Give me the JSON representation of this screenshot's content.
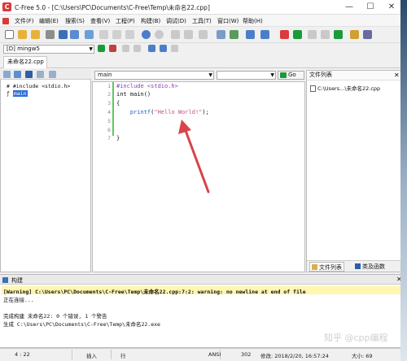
{
  "window": {
    "title": "C-Free 5.0 - [C:\\Users\\PC\\Documents\\C-Free\\Temp\\未命名22.cpp]",
    "app_icon": "C",
    "minimize": "—",
    "maximize": "☐",
    "close": "✕"
  },
  "menu": [
    "文件(F)",
    "编辑(E)",
    "搜索(S)",
    "查看(V)",
    "工程(P)",
    "构建(B)",
    "调试(D)",
    "工具(T)",
    "窗口(W)",
    "帮助(H)"
  ],
  "compiler": {
    "value": "[D] mingw5"
  },
  "file_tab": "未命名22.cpp",
  "project_tree": {
    "include_item": "#include <stdio.h>",
    "main_item": "main",
    "include_glyph": "#",
    "func_glyph": "ƒ"
  },
  "editor": {
    "scope_combo": "main",
    "go_button": "Go",
    "line_numbers": [
      "1",
      "2",
      "3",
      "4",
      "5",
      "6",
      "7"
    ],
    "code": {
      "line1": "#include <stdio.h>",
      "line2": "int main()",
      "line3": "{",
      "line4_indent": "    ",
      "line4_fn": "printf",
      "line4_open": "(",
      "line4_str": "\"Hello World!\"",
      "line4_close": ");",
      "line7": "}"
    }
  },
  "file_list": {
    "header": "文件列表",
    "close": "✕",
    "item": "C:\\Users...\\未命名22.cpp",
    "tab_files": "文件列表",
    "tab_funcs": "类及函数"
  },
  "build": {
    "header": "构建",
    "close": "✕",
    "lines": [
      "[Warning] C:\\Users\\PC\\Documents\\C-Free\\Temp\\未命名22.cpp:7:2: warning: no newline at end of file",
      "正在连接...",
      "",
      "完成构建 未命名22: 0 个错误, 1 个警告",
      "生成 C:\\Users\\PC\\Documents\\C-Free\\Temp\\未命名22.exe"
    ]
  },
  "status": {
    "position": "4 : 22",
    "mode": "插入",
    "line_label": "行",
    "encoding": "ANSI",
    "size_value": "302",
    "modified": "修改: 2018/2/20, 16:57:24",
    "size": "大小: 69"
  },
  "watermark": "知乎 @cpp编程",
  "colors": {
    "selection": "#2d6fd6",
    "warning_bg": "#fff6b0",
    "string": "#c4508a",
    "function": "#1e5ecf",
    "include": "#8a3bbd",
    "arrow": "#d9434a"
  }
}
